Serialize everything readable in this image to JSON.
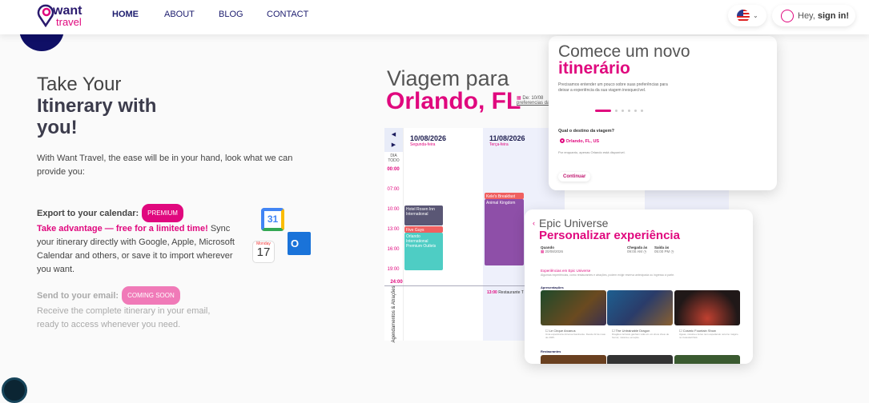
{
  "header": {
    "logo_want": "want",
    "logo_travel": "travel",
    "nav": [
      "HOME",
      "ABOUT",
      "BLOG",
      "CONTACT"
    ],
    "greeting": "Hey,",
    "sign_in": "sign in!"
  },
  "hero": {
    "title_light": "Take Your",
    "title_bold": "Itinerary with you!",
    "intro": "With Want Travel, the ease will be in your hand, look what we can provide you:",
    "export_label": "Export to your calendar:",
    "premium_badge": "PREMIUM",
    "export_highlight": "Take advantage — free for a limited time!",
    "export_text": "Sync your itinerary directly with Google, Apple, Microsoft Calendar and others, or save it to import wherever you want.",
    "email_label": "Send to your email:",
    "coming_badge": "COMING SOON",
    "email_text": "Receive the complete itinerary in your email, ready to access whenever you need.",
    "gcal_day": "31",
    "apple_month": "Monday",
    "apple_day": "17"
  },
  "mock": {
    "title_light": "Viagem para",
    "title_bold": "Orlando, FL",
    "date_text": "De: 10/08",
    "pref_link": "preferencias da v",
    "days": [
      {
        "date": "10/08/2026",
        "weekday": "Segunda-feira"
      },
      {
        "date": "11/08/2026",
        "weekday": "Terça-feira"
      }
    ],
    "all_day": "DIA TODO",
    "times": [
      "00:00",
      "07:00",
      "10:00",
      "13:00",
      "16:00",
      "19:00",
      "24:00"
    ],
    "events": [
      "Hotel Rosen Inn International",
      "Five Guys",
      "Orlando International Premium Outlets",
      "Kele's Breakfast",
      "Animal Kingdom"
    ],
    "bottom_label": "Agendamentos & Atrações",
    "bottom_event_time": "13:00",
    "bottom_event": "Restaurante T"
  },
  "card1": {
    "title_light": "Comece um novo",
    "title_bold": "itinerário",
    "desc": "Precisamos entender um pouco sobre suas preferências para deixar a experiência da sua viagem inesquecível.",
    "question": "Qual o destino da viagem?",
    "option": "Orlando, FL, US",
    "note": "Por enquanto, apenas Orlando está disponível.",
    "continue": "Continuar"
  },
  "card2": {
    "title_light": "Epic Universe",
    "title_bold": "Personalizar experiência",
    "when_label": "Quando",
    "when": "20/08/2026",
    "arrival_label": "Chegada às",
    "arrival": "09:00 AM",
    "exit_label": "Saída às",
    "exit": "05:00 PM",
    "section": "Experiências em Epic Universe",
    "section_desc": "Algumas experiências, como restaurantes e atrações, podem exigir reserva antecipada ou ingresso à parte.",
    "shows_label": "Apresentações",
    "shows": [
      {
        "name": "Le Cirque Arcanus",
        "desc": "Uma experiência circense fascinante. Desde 22 de maio de 2025."
      },
      {
        "name": "The Untrainable Dragon",
        "desc": "Dragões incríveis ganham vida em um show cheio de humor, música e emoção."
      },
      {
        "name": "Cosmic Fountain Show",
        "desc": "Águas, música e luzes num espetáculo noturno mágico no Celestial Park."
      }
    ],
    "restaurants_label": "Restaurantes"
  }
}
